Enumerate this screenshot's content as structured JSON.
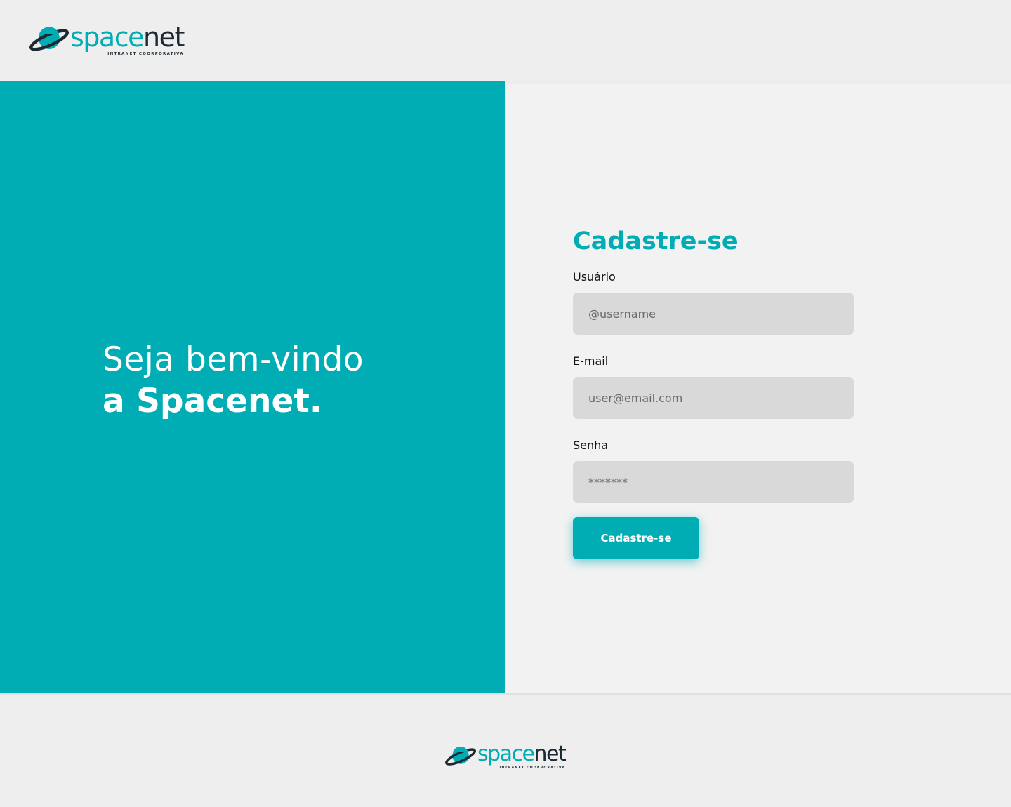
{
  "brand": {
    "name_part1": "space",
    "name_part2": "net",
    "tagline": "INTRANET  COORPORATIVA",
    "primary_color": "#00adb5",
    "dark_color": "#1c2b33",
    "icon": "planet-icon"
  },
  "hero": {
    "line1": "Seja bem-vindo",
    "line2": "a Spacenet."
  },
  "form": {
    "title": "Cadastre-se",
    "username": {
      "label": "Usuário",
      "placeholder": "@username",
      "value": ""
    },
    "email": {
      "label": "E-mail",
      "placeholder": "user@email.com",
      "value": ""
    },
    "password": {
      "label": "Senha",
      "placeholder": "*******",
      "value": ""
    },
    "submit_label": "Cadastre-se"
  }
}
